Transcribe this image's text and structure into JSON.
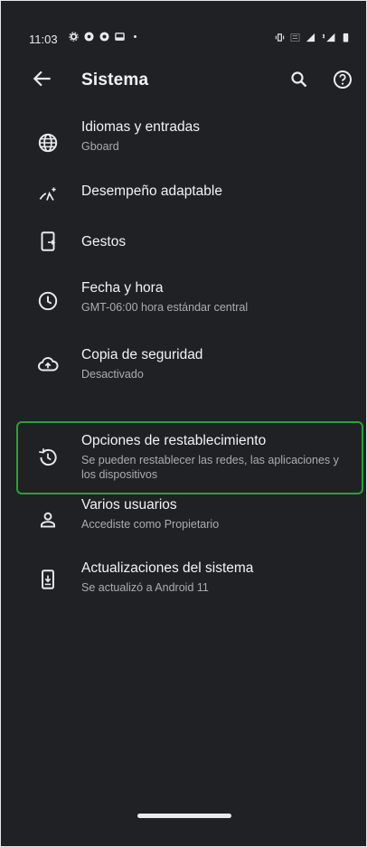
{
  "status": {
    "time": "11:03"
  },
  "appbar": {
    "title": "Sistema"
  },
  "items": [
    {
      "label": "Idiomas y entradas",
      "sub": "Gboard",
      "icon": "globe-icon"
    },
    {
      "label": "Desempeño adaptable",
      "sub": "",
      "icon": "adaptive-performance-icon"
    },
    {
      "label": "Gestos",
      "sub": "",
      "icon": "phone-gesture-icon"
    },
    {
      "label": "Fecha y hora",
      "sub": "GMT-06:00 hora estándar central",
      "icon": "clock-icon"
    },
    {
      "label": "Copia de seguridad",
      "sub": "Desactivado",
      "icon": "cloud-upload-icon"
    },
    {
      "label": "Opciones de restablecimiento",
      "sub": "Se pueden restablecer las redes, las aplicaciones y los dispositivos",
      "icon": "history-icon"
    },
    {
      "label": "Varios usuarios",
      "sub": "Accediste como Propietario",
      "icon": "person-icon"
    },
    {
      "label": "Actualizaciones del sistema",
      "sub": "Se actualizó a Android 11",
      "icon": "system-update-icon"
    }
  ],
  "colors": {
    "background": "#202124",
    "highlight_border": "#2e9e3a"
  }
}
